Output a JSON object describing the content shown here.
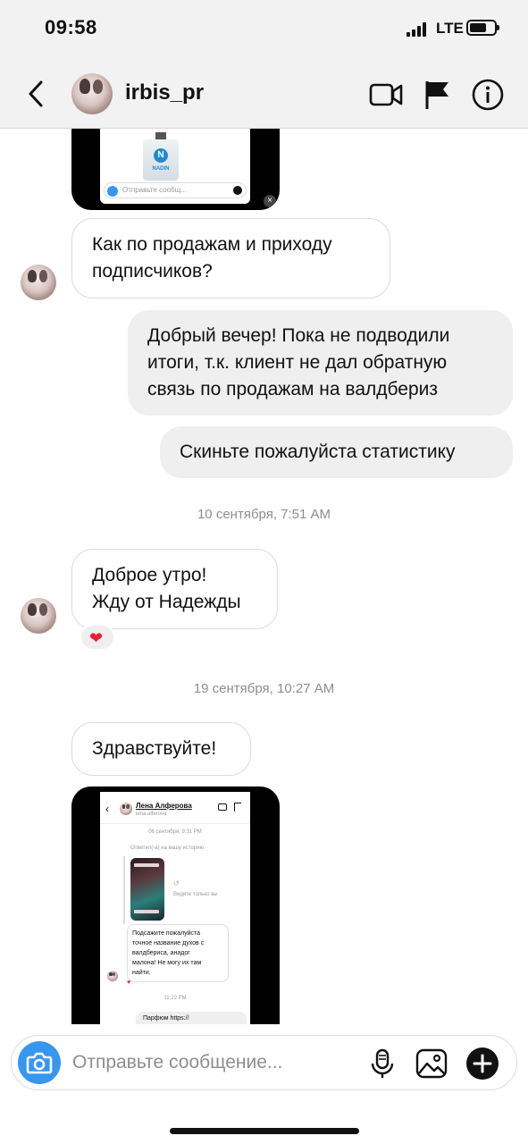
{
  "status_bar": {
    "time": "09:58",
    "network": "LTE"
  },
  "header": {
    "username": "irbis_pr"
  },
  "top_shot": {
    "brand": "NADIN",
    "letter": "N",
    "placeholder": "Отправьте сообщ..."
  },
  "messages": [
    {
      "id": "m1",
      "side": "incoming",
      "lines": [
        "Как по продажам и приходу",
        "подписчиков?"
      ]
    },
    {
      "id": "m2",
      "side": "outgoing",
      "lines": [
        "Добрый вечер! Пока не подводили",
        "итоги, т.к. клиент не дал обратную",
        "связь по продажам на валдбериз"
      ]
    },
    {
      "id": "m3",
      "side": "outgoing",
      "lines": [
        "Скиньте пожалуйста статистику"
      ]
    },
    {
      "id": "m4",
      "side": "incoming",
      "lines": [
        "Доброе утро!",
        "Жду от Надежды"
      ],
      "reaction": "❤"
    },
    {
      "id": "m5",
      "side": "incoming",
      "lines": [
        "Здравствуйте!"
      ]
    }
  ],
  "timestamps": [
    "10 сентября, 7:51 AM",
    "19 сентября, 10:27 AM"
  ],
  "bottom_shot": {
    "name": "Лена Алферова",
    "handle": "lena.alferova",
    "date": "06 сентября, 9:31 PM",
    "reply_note": "Ответил(-а) на вашу историю",
    "seen_note": "Видите только вы",
    "message": [
      "Подсажите пожалуйста",
      "точное название духов с",
      "валдбериса, анадог",
      "малона! Не могу их там",
      "найти."
    ],
    "time2": "11:22 PM",
    "reply": "Парфюм https://"
  },
  "composer": {
    "placeholder": "Отправьте сообщение..."
  },
  "colors": {
    "accent": "#3797f0",
    "outgoing_bubble": "#efefef",
    "reaction": "#ed1c3a"
  }
}
